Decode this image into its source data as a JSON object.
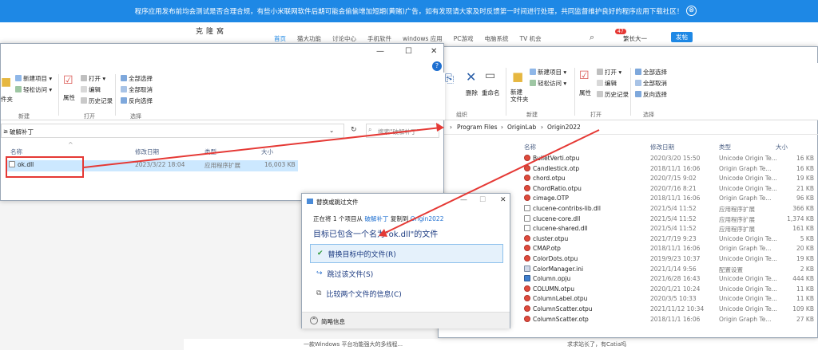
{
  "banner": {
    "text": "程序应用发布前均会测试是否合理合规，有些小米联网软件后期可能会偷偷增加短期(黄赌)广告，如有发现请大家及时反馈第一时间进行处理，共同监督维护良好的程序应用下载社区！",
    "close": "⊗"
  },
  "site": {
    "logo": "克隆窝",
    "nav": [
      "首页",
      "猫大功能",
      "讨论中心",
      "手机软件",
      "windows 应用",
      "PC游戏",
      "电脑系统",
      "TV 机会"
    ],
    "badge": "47",
    "user": "繁长大一",
    "post_button": "发帖",
    "bottom_text": "一款Windows 平台功能强大的多线程...",
    "bottom_text2": "求求站长了，有Catia吗"
  },
  "left_explorer": {
    "ribbon": {
      "new_item": "新建项目",
      "easy_access": "轻松访问",
      "new_group": "新建",
      "folder_suffix": "件夹",
      "properties": "属性",
      "open": "打开",
      "edit": "编辑",
      "history": "历史记录",
      "open_group": "打开",
      "select_all": "全部选择",
      "select_none": "全部取消",
      "invert": "反向选择",
      "select_group": "选择"
    },
    "address": "破解补丁",
    "address_prefix": "≥",
    "search_placeholder": "搜索\"破解补丁\"",
    "columns": {
      "name": "名称",
      "date": "修改日期",
      "type": "类型",
      "size": "大小"
    },
    "file": {
      "name": "ok.dll",
      "date": "2023/3/22 18:04",
      "type": "应用程序扩展",
      "size": "16,003 KB"
    }
  },
  "right_explorer": {
    "ribbon": {
      "delete": "删除",
      "rename": "重命名",
      "org_group": "组织",
      "new_item": "新建项目",
      "easy_access": "轻松访问",
      "new_folder": "新建\n文件夹",
      "new_group": "新建",
      "properties": "属性",
      "open": "打开",
      "edit": "编辑",
      "history": "历史记录",
      "open_group": "打开",
      "select_all": "全部选择",
      "select_none": "全部取消",
      "invert": "反向选择",
      "select_group": "选择"
    },
    "breadcrumb": [
      "Program Files",
      "OriginLab",
      "Origin2022"
    ],
    "columns": {
      "name": "名称",
      "date": "修改日期",
      "type": "类型",
      "size": "大小"
    },
    "files": [
      {
        "name": "BulletVerti.otpu",
        "date": "2020/3/20 15:50",
        "type": "Unicode Origin Te...",
        "size": "16 KB",
        "icon": "otp"
      },
      {
        "name": "Candlestick.otp",
        "date": "2018/11/1 16:06",
        "type": "Origin Graph Te...",
        "size": "16 KB",
        "icon": "otp"
      },
      {
        "name": "chord.otpu",
        "date": "2020/7/15 9:02",
        "type": "Unicode Origin Te...",
        "size": "19 KB",
        "icon": "otp"
      },
      {
        "name": "ChordRatio.otpu",
        "date": "2020/7/16 8:21",
        "type": "Unicode Origin Te...",
        "size": "21 KB",
        "icon": "otp"
      },
      {
        "name": "cimage.OTP",
        "date": "2018/11/1 16:06",
        "type": "Origin Graph Te...",
        "size": "96 KB",
        "icon": "otp"
      },
      {
        "name": "clucene-contribs-lib.dll",
        "date": "2021/5/4 11:52",
        "type": "应用程序扩展",
        "size": "366 KB",
        "icon": "dll"
      },
      {
        "name": "clucene-core.dll",
        "date": "2021/5/4 11:52",
        "type": "应用程序扩展",
        "size": "1,374 KB",
        "icon": "dll"
      },
      {
        "name": "clucene-shared.dll",
        "date": "2021/5/4 11:52",
        "type": "应用程序扩展",
        "size": "161 KB",
        "icon": "dll"
      },
      {
        "name": "cluster.otpu",
        "date": "2021/7/19 9:23",
        "type": "Unicode Origin Te...",
        "size": "5 KB",
        "icon": "otp"
      },
      {
        "name": "CMAP.otp",
        "date": "2018/11/1 16:06",
        "type": "Origin Graph Te...",
        "size": "20 KB",
        "icon": "otp"
      },
      {
        "name": "ColorDots.otpu",
        "date": "2019/9/23 10:37",
        "type": "Unicode Origin Te...",
        "size": "19 KB",
        "icon": "otp"
      },
      {
        "name": "ColorManager.ini",
        "date": "2021/1/14 9:56",
        "type": "配置设置",
        "size": "2 KB",
        "icon": "cfg"
      },
      {
        "name": "Column.opju",
        "date": "2021/6/28 16:43",
        "type": "Unicode Origin Te...",
        "size": "444 KB",
        "icon": "opju"
      },
      {
        "name": "COLUMN.otpu",
        "date": "2020/1/21 10:24",
        "type": "Unicode Origin Te...",
        "size": "11 KB",
        "icon": "otp"
      },
      {
        "name": "ColumnLabel.otpu",
        "date": "2020/3/5 10:33",
        "type": "Unicode Origin Te...",
        "size": "11 KB",
        "icon": "otp"
      },
      {
        "name": "ColumnScatter.otpu",
        "date": "2021/11/12 10:34",
        "type": "Unicode Origin Te...",
        "size": "109 KB",
        "icon": "otp"
      },
      {
        "name": "ColumnScatter.otp",
        "date": "2018/11/1 16:06",
        "type": "Origin Graph Te...",
        "size": "27 KB",
        "icon": "otp"
      }
    ]
  },
  "dialog": {
    "title": "替换或跳过文件",
    "progress_prefix": "正在将 1 个项目从",
    "from": "破解补丁",
    "to_label": "复制到",
    "to": "Origin2022",
    "message": "目标已包含一个名为\"ok.dll\"的文件",
    "options": [
      "替换目标中的文件(R)",
      "跳过该文件(S)",
      "比较两个文件的信息(C)"
    ],
    "details": "简略信息"
  },
  "colors": {
    "accent": "#1e88e5",
    "annotation": "#e53935"
  }
}
